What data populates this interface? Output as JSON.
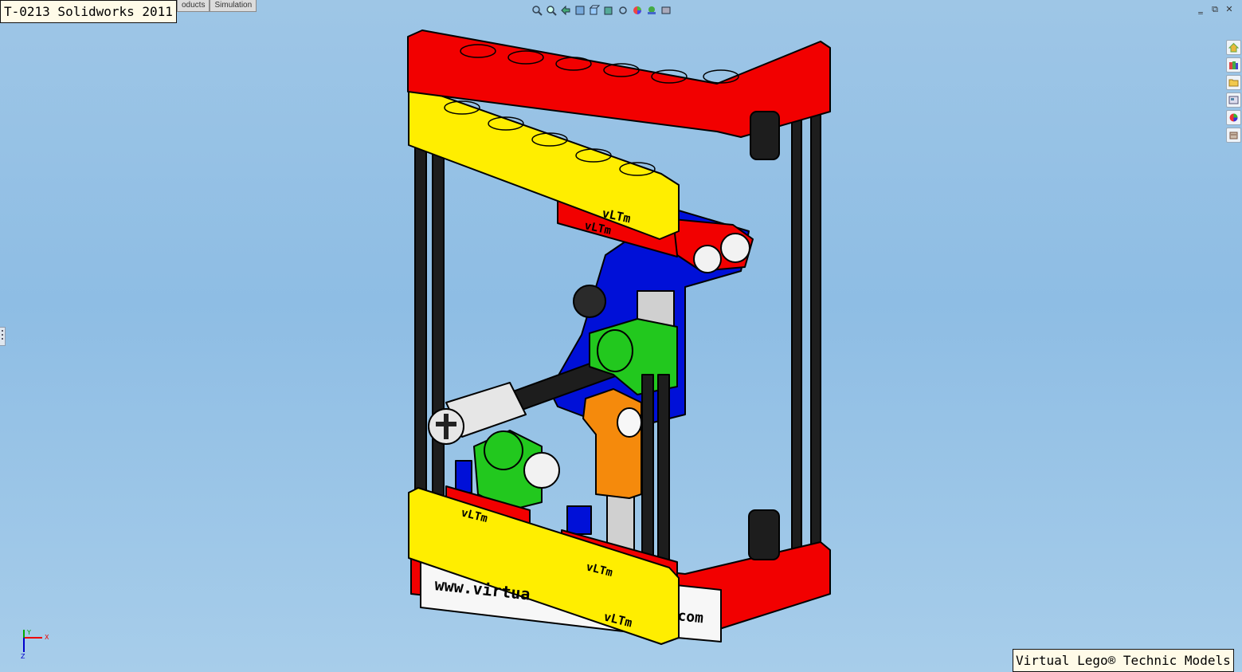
{
  "window_title": "T-0213 Solidworks 2011",
  "tabs": [
    {
      "label": "oducts"
    },
    {
      "label": "Simulation"
    }
  ],
  "heads_up_toolbar": [
    "zoom-to-fit-icon",
    "zoom-to-area-icon",
    "previous-view-icon",
    "section-view-icon",
    "view-orientation-icon",
    "display-style-icon",
    "hide-show-items-icon",
    "edit-appearance-icon",
    "apply-scene-icon",
    "view-settings-icon"
  ],
  "window_controls": {
    "minimize": "‗",
    "restore": "⧉",
    "close": "✕"
  },
  "task_pane": [
    "home-icon",
    "design-library-icon",
    "file-explorer-icon",
    "view-palette-icon",
    "appearances-icon",
    "custom-properties-icon"
  ],
  "model": {
    "brand_labels": [
      "vLTm",
      "vLTm",
      "vLTm",
      "vLTm",
      "vLTm"
    ],
    "plate_text_left": "www.virtua",
    "plate_text_right": "com",
    "colors": {
      "red": "#f20000",
      "yellow": "#ffee00",
      "blue": "#0010d8",
      "green": "#22c81e",
      "orange": "#f58a0c",
      "black": "#1d1d1d",
      "grey": "#d0d0d0",
      "white": "#f7f7f7"
    }
  },
  "triad": {
    "x_label": "X",
    "y_label": "Y",
    "z_label": "Z"
  },
  "watermark": "Virtual Lego® Technic Models"
}
